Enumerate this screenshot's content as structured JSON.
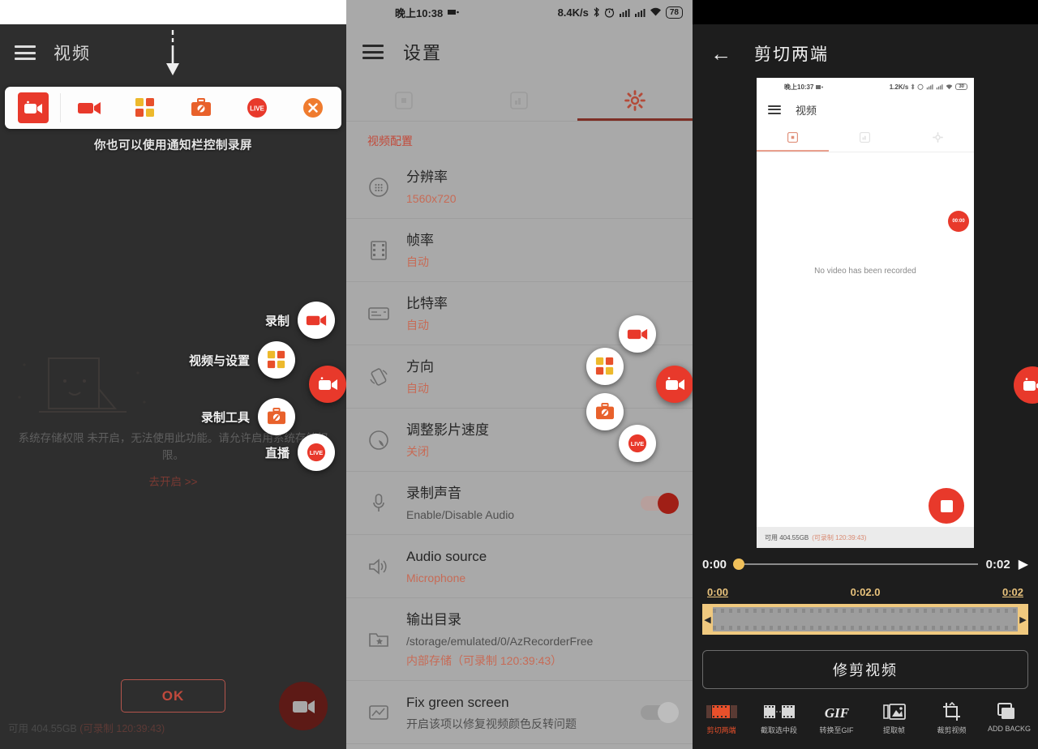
{
  "panel1": {
    "appbar": {
      "title": "视频",
      "menu_icon": "hamburger-menu-icon",
      "arrow_icon": "down-arrow-icon"
    },
    "toolbar_card": {
      "items": [
        {
          "name": "record-screen-icon",
          "label": "录屏",
          "selected": true
        },
        {
          "name": "video-camera-icon",
          "label": "录制"
        },
        {
          "name": "grid-apps-icon",
          "label": "视频与设置"
        },
        {
          "name": "toolbox-icon",
          "label": "录制工具"
        },
        {
          "name": "live-icon",
          "label": "直播"
        },
        {
          "name": "close-circle-icon",
          "label": "关闭"
        }
      ]
    },
    "hint": "你也可以使用通知栏控制录屏",
    "coach_marks": [
      {
        "label": "录制",
        "icon": "video-camera-icon"
      },
      {
        "label": "视频与设置",
        "icon": "grid-apps-icon"
      },
      {
        "label": "录制工具",
        "icon": "toolbox-icon"
      },
      {
        "label": "直播",
        "icon": "live-icon"
      }
    ],
    "permission_text": "系统存储权限 未开启，无法使用此功能。请允许启用系统存储权限。",
    "permission_link": "去开启 >>",
    "ok_button": "OK",
    "storage_text": "可用 404.55GB",
    "storage_highlight": "(可录制 120:39:43)",
    "record_fab": "record-fab-icon"
  },
  "panel2": {
    "statusbar": {
      "time": "晚上10:38",
      "net_speed": "8.4K/s",
      "battery": "78",
      "icons": [
        "bluetooth-icon",
        "alarm-icon",
        "signal-1-icon",
        "signal-2-icon",
        "wifi-icon",
        "battery-icon"
      ]
    },
    "appbar": {
      "title": "设置",
      "menu_icon": "hamburger-menu-icon"
    },
    "tabs": [
      {
        "name": "tab-videos",
        "icon": "video-box-icon",
        "active": false
      },
      {
        "name": "tab-images",
        "icon": "image-box-icon",
        "active": false
      },
      {
        "name": "tab-settings",
        "icon": "gear-icon",
        "active": true
      }
    ],
    "section_title": "视频配置",
    "rows": [
      {
        "icon": "resolution-icon",
        "title": "分辨率",
        "value": "1560x720",
        "value_style": "accent"
      },
      {
        "icon": "film-icon",
        "title": "帧率",
        "value": "自动",
        "value_style": "accent"
      },
      {
        "icon": "bitrate-icon",
        "title": "比特率",
        "value": "自动",
        "value_style": "accent"
      },
      {
        "icon": "rotate-icon",
        "title": "方向",
        "value": "自动",
        "value_style": "accent"
      },
      {
        "icon": "speed-icon",
        "title": "调整影片速度",
        "value": "关闭",
        "value_style": "accent"
      },
      {
        "icon": "microphone-icon",
        "title": "录制声音",
        "value": "Enable/Disable Audio",
        "value_style": "muted",
        "toggle": "on"
      },
      {
        "icon": "speaker-icon",
        "title": "Audio source",
        "value": "Microphone",
        "value_style": "accent"
      },
      {
        "icon": "folder-star-icon",
        "title": "输出目录",
        "value": "/storage/emulated/0/AzRecorderFree",
        "value2": "内部存储（可录制 120:39:43）",
        "value_style": "muted"
      },
      {
        "icon": "image-fix-icon",
        "title": "Fix green screen",
        "value": "开启该项以修复视频颜色反转问题",
        "value_style": "muted",
        "toggle": "off"
      }
    ],
    "floating_buttons": [
      {
        "name": "record-float-button",
        "icon": "video-camera-icon"
      },
      {
        "name": "apps-float-button",
        "icon": "grid-apps-icon"
      },
      {
        "name": "tools-float-button",
        "icon": "toolbox-icon"
      },
      {
        "name": "live-float-button",
        "icon": "live-icon"
      },
      {
        "name": "main-record-fab",
        "icon": "record-fab-icon"
      }
    ]
  },
  "panel3": {
    "appbar": {
      "title": "剪切两端",
      "back_icon": "back-arrow-icon"
    },
    "preview": {
      "statusbar": {
        "time": "晚上10:37",
        "net_speed": "1.2K/s",
        "battery": "30"
      },
      "appbar_title": "视频",
      "tabs": [
        "video-box-icon",
        "image-box-icon",
        "gear-icon"
      ],
      "empty_text": "No video has been recorded",
      "storage_text": "可用 404.55GB",
      "storage_highlight": "(可录制 120:39:43)",
      "badge": "00:00"
    },
    "seek": {
      "current": "0:00",
      "duration": "0:02",
      "play_icon": "play-icon"
    },
    "timeline_ticks": [
      "0:00",
      "0:02.0",
      "0:02"
    ],
    "trim_button": "修剪视频",
    "bottom_tools": [
      {
        "label": "剪切两端",
        "icon": "trim-ends-icon",
        "active": true
      },
      {
        "label": "截取选中段",
        "icon": "cut-segment-icon",
        "active": false
      },
      {
        "label": "转换至GIF",
        "icon": "gif-icon",
        "active": false
      },
      {
        "label": "提取帧",
        "icon": "extract-frame-icon",
        "active": false
      },
      {
        "label": "裁剪视频",
        "icon": "crop-icon",
        "active": false
      },
      {
        "label": "ADD BACKG",
        "icon": "add-background-icon",
        "active": false
      }
    ],
    "edge_fab": "record-fab-icon"
  },
  "colors": {
    "accent_red": "#e8392b",
    "accent_orange": "#c24a3a",
    "trim_gold": "#f0c97f"
  }
}
